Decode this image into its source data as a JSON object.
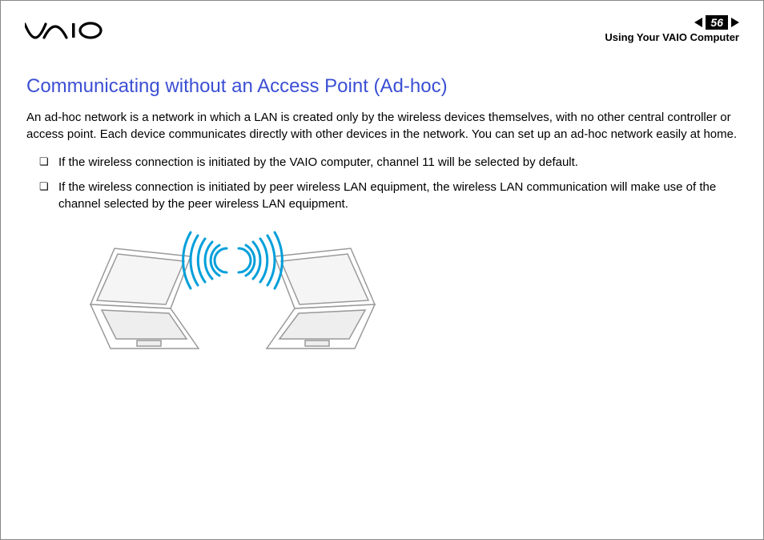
{
  "header": {
    "page_number": "56",
    "breadcrumb": "Using Your VAIO Computer"
  },
  "content": {
    "title": "Communicating without an Access Point (Ad-hoc)",
    "intro": "An ad-hoc network is a network in which a LAN is created only by the wireless devices themselves, with no other central controller or access point. Each device communicates directly with other devices in the network. You can set up an ad-hoc network easily at home.",
    "bullets": [
      "If the wireless connection is initiated by the VAIO computer, channel 11 will be selected by default.",
      "If the wireless connection is initiated by peer wireless LAN equipment, the wireless LAN communication will make use of the channel selected by the peer wireless LAN equipment."
    ]
  }
}
